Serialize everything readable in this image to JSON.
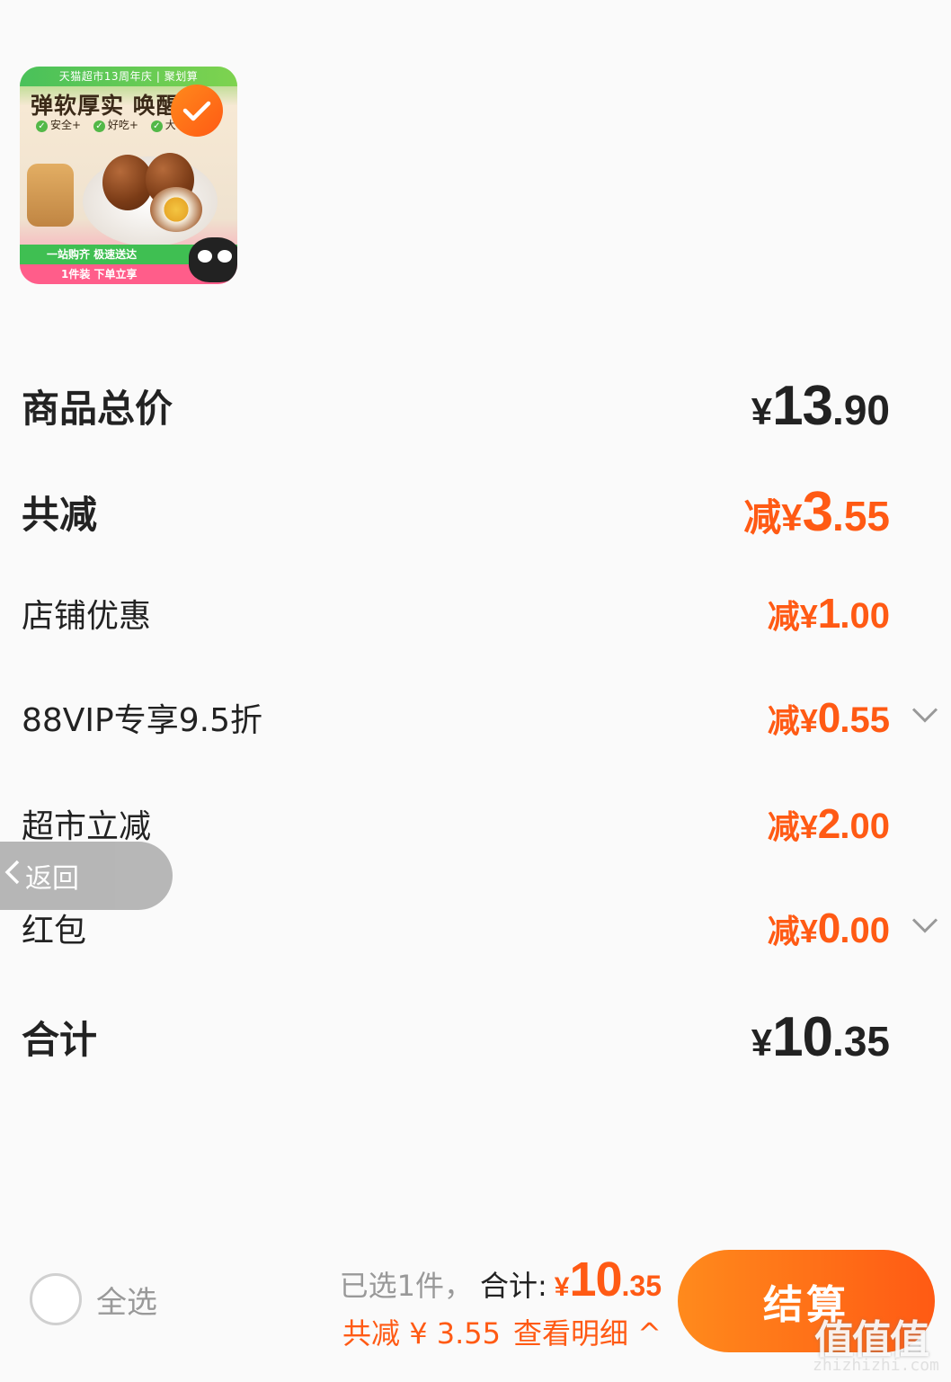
{
  "product": {
    "thumb_top_band": "天猫超市13周年庆 | 聚划算",
    "thumb_headline": "弹软厚实 唤醒",
    "thumb_badges": [
      "安全+",
      "好吃+",
      "大"
    ],
    "thumb_green_band": "一站购齐 极速送达",
    "thumb_pink_band": "1件装 下单立享",
    "selected": true
  },
  "rows": {
    "total_price": {
      "label": "商品总价",
      "currency": "¥",
      "int": "13",
      "dec": ".90"
    },
    "total_discount": {
      "label": "共减",
      "prefix": "减",
      "currency": "¥",
      "int": "3",
      "dec": ".55"
    },
    "shop_discount": {
      "label": "店铺优惠",
      "prefix": "减",
      "currency": "¥",
      "int": "1",
      "dec": ".00"
    },
    "vip_discount": {
      "label": "88VIP专享9.5折",
      "prefix": "减",
      "currency": "¥",
      "int": "0",
      "dec": ".55",
      "icon": "chevron-down-icon"
    },
    "market_discount": {
      "label": "超市立减",
      "prefix": "减",
      "currency": "¥",
      "int": "2",
      "dec": ".00"
    },
    "red_packet": {
      "label": "红包",
      "prefix": "减",
      "currency": "¥",
      "int": "0",
      "dec": ".00",
      "icon": "chevron-down-icon"
    },
    "grand_total": {
      "label": "合计",
      "currency": "¥",
      "int": "10",
      "dec": ".35"
    }
  },
  "back_button": {
    "label": "返回",
    "icon": "chevron-left-icon"
  },
  "bottom_bar": {
    "select_all": "全选",
    "selected_count": "已选1件，",
    "total_label": "合计:",
    "total_currency": "¥",
    "total_int": "10",
    "total_dec": ".35",
    "discount_text": "共减 ¥ 3.55",
    "detail_link": "查看明细 ^",
    "checkout": "结算"
  },
  "watermark": {
    "text": "值值值",
    "url": "zhizhizhi.com"
  },
  "colors": {
    "accent": "#ff5a14",
    "accent_light": "#ff8a1c",
    "text": "#222222",
    "muted": "#999999"
  }
}
